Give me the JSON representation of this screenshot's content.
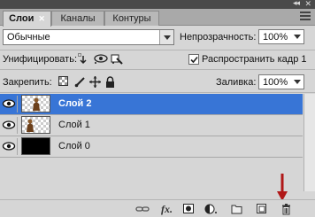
{
  "tabs": [
    {
      "label": "Слои",
      "active": true
    },
    {
      "label": "Каналы",
      "active": false
    },
    {
      "label": "Контуры",
      "active": false
    }
  ],
  "tab_close_glyph": "✕",
  "collapse_glyph": "◂◂",
  "blend_mode": "Обычные",
  "opacity": {
    "label": "Непрозрачность:",
    "value": "100%"
  },
  "unify": {
    "label": "Унифицировать:"
  },
  "propagate": {
    "label": "Распространить кадр 1",
    "checked": true
  },
  "lock": {
    "label": "Закрепить:"
  },
  "fill": {
    "label": "Заливка:",
    "value": "100%"
  },
  "layers": [
    {
      "name": "Слой 2",
      "selected": true,
      "visible": true,
      "thumb": "transparent-with-figure"
    },
    {
      "name": "Слой 1",
      "selected": false,
      "visible": true,
      "thumb": "transparent-with-figure"
    },
    {
      "name": "Слой 0",
      "selected": false,
      "visible": true,
      "thumb": "black-fill"
    }
  ],
  "bottom_icons": [
    "link-icon",
    "fx-icon",
    "layer-mask-icon",
    "adjustment-layer-icon",
    "new-group-icon",
    "new-layer-icon",
    "delete-layer-icon"
  ],
  "colors": {
    "selection": "#3875d6",
    "panel": "#d6d6d6",
    "annotation_arrow": "#b01818"
  }
}
